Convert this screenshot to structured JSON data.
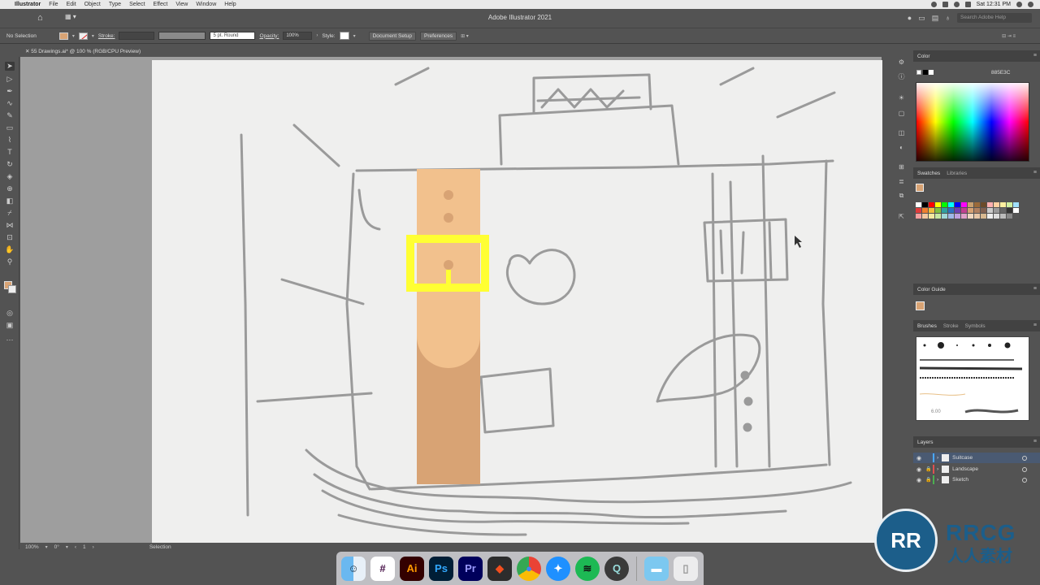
{
  "menubar": {
    "app_name": "Illustrator",
    "items": [
      "File",
      "Edit",
      "Object",
      "Type",
      "Select",
      "Effect",
      "View",
      "Window",
      "Help"
    ],
    "clock": "Sat 12:31 PM"
  },
  "titlebar": {
    "title": "Adobe Illustrator 2021",
    "search_placeholder": "Search Adobe Help"
  },
  "controlbar": {
    "selection": "No Selection",
    "stroke_label": "Stroke:",
    "brush_value": "5 pt. Round",
    "opacity_label": "Opacity:",
    "opacity_value": "100%",
    "style_label": "Style:",
    "document_setup": "Document Setup",
    "preferences": "Preferences"
  },
  "document": {
    "tab_label": "55 Drawings.ai* @ 100 % (RGB/CPU Preview)"
  },
  "statusbar": {
    "zoom": "100%",
    "rotation": "0°",
    "artboard": "1",
    "tool": "Selection"
  },
  "panels": {
    "color_tab": "Color",
    "hex": "885E3C",
    "swatches_tab": "Swatches",
    "libraries_tab": "Libraries",
    "color_guide_tab": "Color Guide",
    "brushes_tab": "Brushes",
    "stroke_tab": "Stroke",
    "symbols_tab": "Symbols",
    "brush_size": "6.00",
    "layers_tab": "Layers",
    "layers": [
      {
        "name": "Suitcase",
        "color": "#4aa8ff",
        "selected": true
      },
      {
        "name": "Landscape",
        "color": "#e05050",
        "selected": false
      },
      {
        "name": "Sketch",
        "color": "#4caf50",
        "selected": false
      }
    ]
  },
  "colors": {
    "fill": "#d8a374",
    "strap_light": "#f2c18d",
    "strap_dark": "#d8a374",
    "highlight": "#ffff33",
    "accent_blue": "#1c5e8a"
  },
  "dock": {
    "apps": [
      {
        "icon": "finder-icon",
        "label": ""
      },
      {
        "icon": "slack-icon",
        "label": ""
      },
      {
        "icon": "illustrator-icon",
        "label": "Ai"
      },
      {
        "icon": "photoshop-icon",
        "label": "Ps"
      },
      {
        "icon": "premiere-icon",
        "label": "Pr"
      },
      {
        "icon": "figma-icon",
        "label": ""
      },
      {
        "icon": "chrome-icon",
        "label": ""
      },
      {
        "icon": "safari-icon",
        "label": ""
      },
      {
        "icon": "spotify-icon",
        "label": ""
      },
      {
        "icon": "quicktime-icon",
        "label": ""
      },
      {
        "icon": "folder-icon",
        "label": ""
      },
      {
        "icon": "trash-icon",
        "label": ""
      }
    ]
  },
  "watermark": {
    "logo_text": "RR",
    "brand": "RRCG",
    "sub": "人人素材"
  }
}
